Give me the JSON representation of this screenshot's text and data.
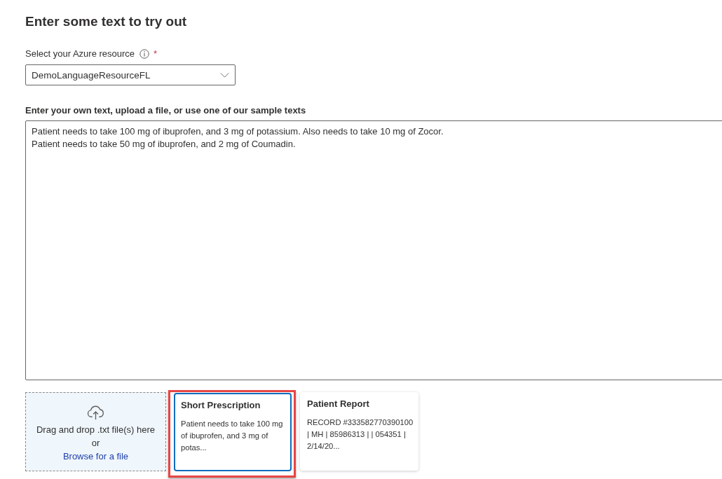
{
  "page": {
    "title": "Enter some text to try out"
  },
  "resource": {
    "label": "Select your Azure resource",
    "required_mark": "*",
    "value": "DemoLanguageResourceFL"
  },
  "text_input": {
    "label": "Enter your own text, upload a file, or use one of our sample texts",
    "value": "Patient needs to take 100 mg of ibuprofen, and 3 mg of potassium. Also needs to take 10 mg of Zocor.\nPatient needs to take 50 mg of ibuprofen, and 2 mg of Coumadin."
  },
  "upload": {
    "prompt": "Drag and drop .txt file(s) here",
    "separator": "or",
    "link": "Browse for a file"
  },
  "samples": [
    {
      "title": "Short Prescription",
      "preview": "Patient needs to take 100 mg of ibuprofen, and 3 mg of potas...",
      "selected": true,
      "highlighted": true
    },
    {
      "title": "Patient Report",
      "preview": "RECORD #333582770390100 | MH | 85986313 | | 054351 | 2/14/20...",
      "selected": false,
      "highlighted": false
    }
  ]
}
